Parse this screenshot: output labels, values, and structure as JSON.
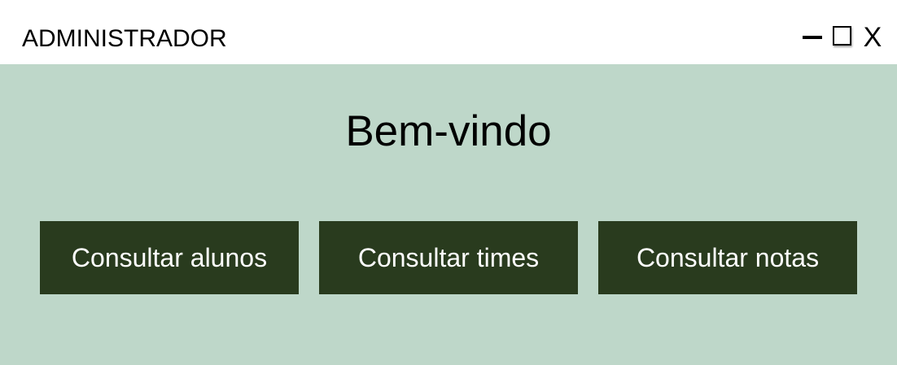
{
  "window": {
    "title": "ADMINISTRADOR",
    "controls": {
      "close_label": "X",
      "minimize_icon": "minimize-icon",
      "maximize_icon": "maximize-icon"
    }
  },
  "main": {
    "welcome": "Bem-vindo",
    "buttons": [
      {
        "label": "Consultar alunos"
      },
      {
        "label": "Consultar times"
      },
      {
        "label": "Consultar notas"
      }
    ]
  },
  "colors": {
    "background": "#bed7c9",
    "button": "#293b1e",
    "button_text": "#ffffff",
    "titlebar": "#ffffff"
  }
}
